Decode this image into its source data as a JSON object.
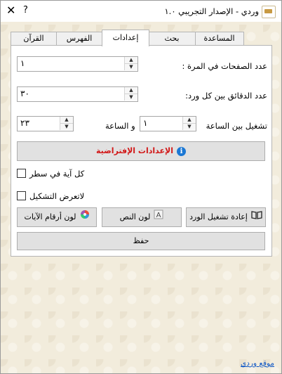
{
  "window": {
    "title": "وردي - الإصدار التجريبي ١.٠",
    "help": "?",
    "close": "✕"
  },
  "tabs": [
    {
      "label": "المساعدة"
    },
    {
      "label": "بحث"
    },
    {
      "label": "إعدادات",
      "active": true
    },
    {
      "label": "الفهرس"
    },
    {
      "label": "القرآن"
    }
  ],
  "settings": {
    "pages_label": "عدد الصفحات في المرة :",
    "pages_value": "١",
    "minutes_label": "عدد الدقائق بين كل ورد:",
    "minutes_value": "٣٠",
    "run_between_label": "تشغيل بين الساعة",
    "start_hour_value": "١",
    "and_hour_label": "و الساعة",
    "end_hour_value": "٢٣",
    "defaults_button": "الإعدادات الإفتراضية",
    "verse_per_line_label": "كل آية في سطر",
    "verse_per_line_checked": false,
    "no_tashkeel_label": "لاتعرض التشكيل",
    "no_tashkeel_checked": false,
    "replay_button": "إعادة تشغيل الورد",
    "text_color_button": "لون النص",
    "verse_num_color_button": "لون أرقام الآيات",
    "save_button": "حفظ"
  },
  "footer": {
    "site_link": "موقع وردي"
  },
  "colors": {
    "defaults_text": "#d21818",
    "info_icon": "#1c78d4",
    "link": "#0b55c5"
  }
}
